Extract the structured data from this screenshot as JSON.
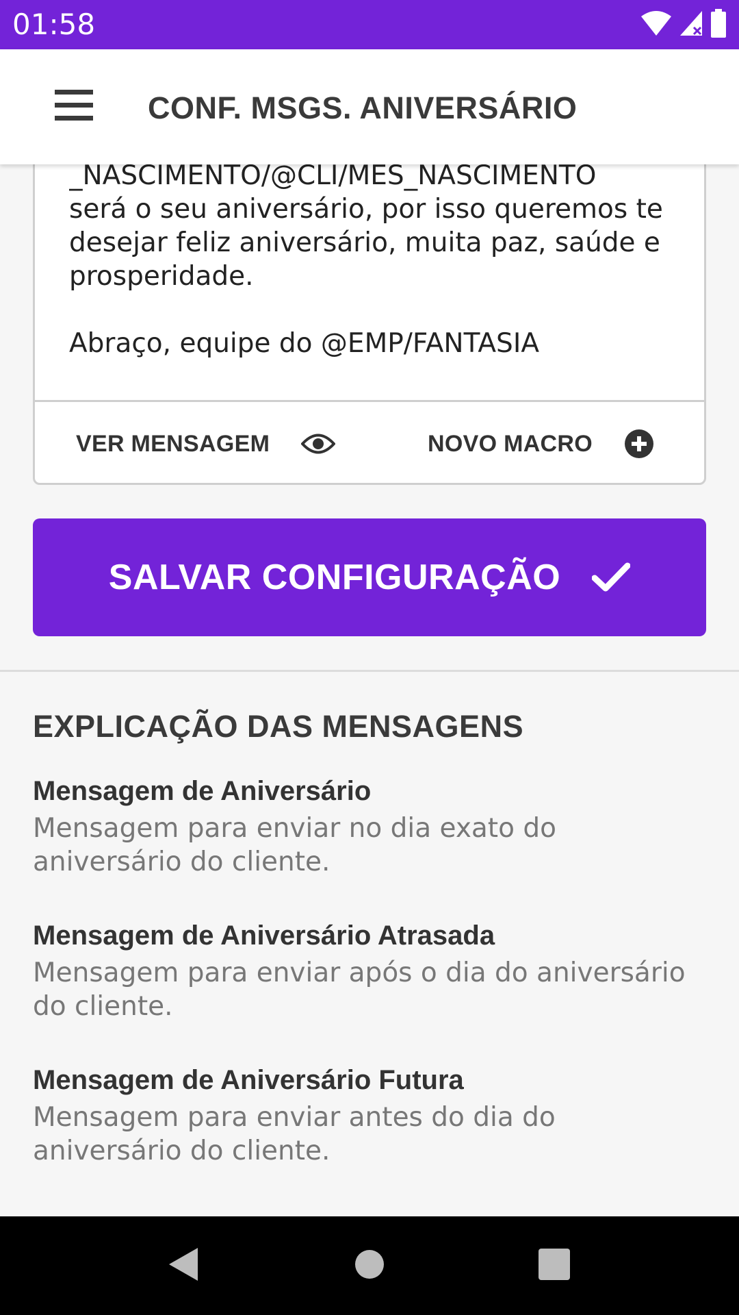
{
  "status_bar": {
    "time": "01:58",
    "icons": [
      "wifi-icon",
      "cell-signal-icon",
      "battery-icon"
    ]
  },
  "app_bar": {
    "menu_icon": "hamburger-menu-icon",
    "title": "CONF. MSGS. ANIVERSÁRIO"
  },
  "editor": {
    "message": "Olá @CLI/NOME neste dia @CLI/DIA\n_NASCIMENTO/@CLI/MES_NASCIMENTO\nserá o seu aniversário, por isso queremos te\ndesejar feliz aniversário, muita paz, saúde e\nprosperidade.\n\nAbraço, equipe do @EMP/FANTASIA",
    "view_message_label": "VER MENSAGEM",
    "view_message_icon": "eye-icon",
    "new_macro_label": "NOVO MACRO",
    "new_macro_icon": "plus-circle-icon"
  },
  "save": {
    "label": "SALVAR CONFIGURAÇÃO",
    "icon": "check-icon"
  },
  "explanation": {
    "title": "EXPLICAÇÃO DAS MENSAGENS",
    "items": [
      {
        "title": "Mensagem de Aniversário",
        "description": "Mensagem para enviar no dia exato do aniversário do cliente."
      },
      {
        "title": "Mensagem de Aniversário Atrasada",
        "description": "Mensagem para enviar após o dia do aniversário do cliente."
      },
      {
        "title": "Mensagem de Aniversário Futura",
        "description": "Mensagem para enviar antes do dia do aniversário do cliente."
      }
    ]
  },
  "nav_bar": {
    "icons": [
      "back-icon",
      "home-icon",
      "recents-icon"
    ]
  },
  "colors": {
    "primary": "#7323d8",
    "text_dark": "#3a3a3a",
    "text_muted": "#777777",
    "background": "#f6f6f6"
  }
}
